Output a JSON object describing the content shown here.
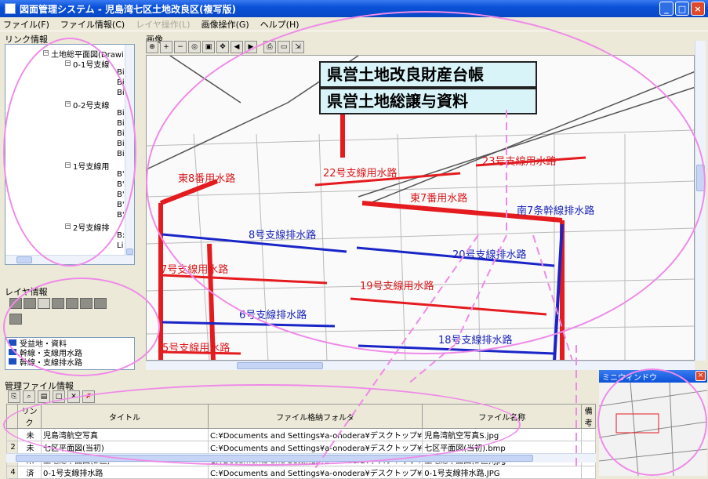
{
  "window": {
    "title": "図面管理システム - 児島湾七区土地改良区(複写版)"
  },
  "menu": [
    {
      "label": "ファイル(F)",
      "enabled": true
    },
    {
      "label": "ファイル情報(C)",
      "enabled": true
    },
    {
      "label": "レイヤ操作(L)",
      "enabled": false
    },
    {
      "label": "画像操作(G)",
      "enabled": true
    },
    {
      "label": "ヘルプ(H)",
      "enabled": true
    }
  ],
  "link_panel": {
    "label": "リンク情報",
    "tree": [
      {
        "text": "土地総平面図(Drawi",
        "level": 0
      },
      {
        "text": "0-1号支線",
        "level": 1
      },
      {
        "text": "Bi",
        "level": 2
      },
      {
        "text": "Bi",
        "level": 2
      },
      {
        "text": "Bi",
        "level": 2
      },
      {
        "text": "0-2号支線",
        "level": 1
      },
      {
        "text": "Bi",
        "level": 2
      },
      {
        "text": "Bi",
        "level": 2
      },
      {
        "text": "Bi",
        "level": 2
      },
      {
        "text": "Bi",
        "level": 2
      },
      {
        "text": "Bi",
        "level": 2
      },
      {
        "text": "1号支線用",
        "level": 1
      },
      {
        "text": "B'",
        "level": 2
      },
      {
        "text": "B'",
        "level": 2
      },
      {
        "text": "B'",
        "level": 2
      },
      {
        "text": "B'",
        "level": 2
      },
      {
        "text": "B'",
        "level": 2
      },
      {
        "text": "2号支線排",
        "level": 1
      },
      {
        "text": "B:",
        "level": 2
      },
      {
        "text": "Li",
        "level": 2
      }
    ]
  },
  "layer_panel": {
    "label": "レイヤ情報",
    "items": [
      {
        "text": "受益地・資料",
        "color": "#1c4fc2"
      },
      {
        "text": "幹線・支線用水路",
        "color": "#1c4fc2"
      },
      {
        "text": "幹線・支線排水路",
        "color": "#1c4fc2"
      }
    ]
  },
  "image_panel": {
    "label": "画像",
    "map_titles": [
      "県営土地改良財産台帳",
      "県営土地総譲与資料"
    ],
    "red_labels": [
      "東8番用水路",
      "22号支線用水路",
      "23号支線用水路",
      "東7番用水路",
      "7号支線用水路",
      "19号支線用水路",
      "5号支線用水路"
    ],
    "blue_labels": [
      "南7条幹線排水路",
      "8号支線排水路",
      "20号支線排水路",
      "6号支線排水路",
      "18号支線排水路"
    ]
  },
  "mgmt_panel": {
    "label": "管理ファイル情報",
    "columns": [
      "リンク",
      "タイトル",
      "ファイル格納フォルダ",
      "ファイル名称",
      "備考"
    ],
    "rows": [
      {
        "no": "",
        "link": "未",
        "title": "児島湾航空写真",
        "folder": "C:¥Documents and Settings¥a-onodera¥デスクトップ¥",
        "file": "児島湾航空写真S.jpg",
        "note": ""
      },
      {
        "no": "2",
        "link": "未",
        "title": "七区平面図(当初)",
        "folder": "C:¥Documents and Settings¥a-onodera¥デスクトップ¥",
        "file": "七区平面図(当初).bmp",
        "note": ""
      },
      {
        "no": "3",
        "link": "未",
        "title": "土地総平面図(D区)",
        "folder": "C:¥Documents and Settings¥a-onodera¥デスクトップ¥",
        "file": "土地総平面図(D区).jpg",
        "note": ""
      },
      {
        "no": "4",
        "link": "済",
        "title": "0-1号支線排水路",
        "folder": "C:¥Documents and Settings¥a-onodera¥デスクトップ¥",
        "file": "0-1号支線排水路.JPG",
        "note": ""
      }
    ]
  },
  "miniwin": {
    "title": "ミニウィンドウ"
  },
  "colors": {
    "accent": "#0a52d8",
    "annotation": "#ef8ae9",
    "canal_red": "#e41b1f",
    "canal_blue": "#1a25c8"
  }
}
